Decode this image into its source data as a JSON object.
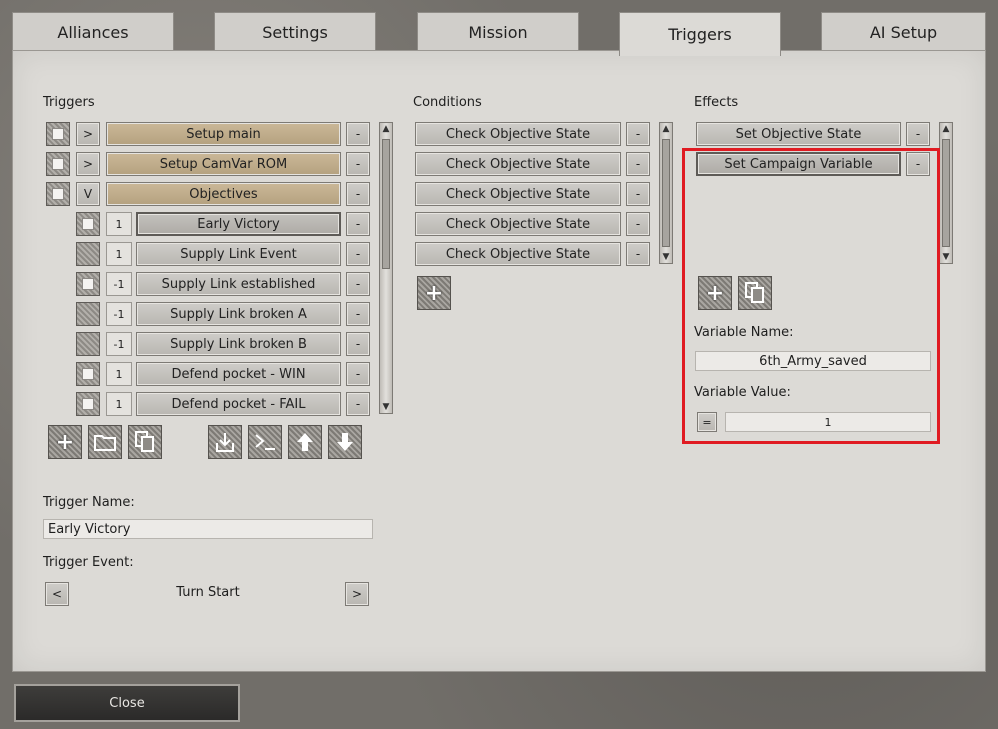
{
  "tabs": [
    "Alliances",
    "Settings",
    "Mission",
    "Triggers",
    "AI Setup"
  ],
  "triggers": {
    "heading": "Triggers",
    "items": [
      {
        "toggle": ">",
        "label": "Setup main",
        "remove": "-"
      },
      {
        "toggle": ">",
        "label": "Setup CamVar ROM",
        "remove": "-"
      },
      {
        "toggle": "V",
        "label": "Objectives",
        "remove": "-"
      },
      {
        "num": "1",
        "label": "Early Victory",
        "remove": "-"
      },
      {
        "num": "1",
        "label": "Supply Link Event",
        "remove": "-"
      },
      {
        "num": "-1",
        "label": "Supply Link established",
        "remove": "-"
      },
      {
        "num": "-1",
        "label": "Supply Link broken A",
        "remove": "-"
      },
      {
        "num": "-1",
        "label": "Supply Link broken B",
        "remove": "-"
      },
      {
        "num": "1",
        "label": "Defend pocket - WIN",
        "remove": "-"
      },
      {
        "num": "1",
        "label": "Defend pocket - FAIL",
        "remove": "-"
      }
    ],
    "trigger_name_label": "Trigger Name:",
    "trigger_name_value": "Early Victory",
    "trigger_event_label": "Trigger Event:",
    "trigger_event_value": "Turn Start",
    "prev": "<",
    "next": ">"
  },
  "conditions": {
    "heading": "Conditions",
    "items": [
      {
        "label": "Check Objective State",
        "remove": "-"
      },
      {
        "label": "Check Objective State",
        "remove": "-"
      },
      {
        "label": "Check Objective State",
        "remove": "-"
      },
      {
        "label": "Check Objective State",
        "remove": "-"
      },
      {
        "label": "Check Objective State",
        "remove": "-"
      }
    ]
  },
  "effects": {
    "heading": "Effects",
    "items": [
      {
        "label": "Set Objective State",
        "remove": "-"
      },
      {
        "label": "Set Campaign Variable",
        "remove": "-"
      }
    ],
    "variable_name_label": "Variable Name:",
    "variable_name_value": "6th_Army_saved",
    "variable_value_label": "Variable Value:",
    "operator": "=",
    "variable_value": "1"
  },
  "close_label": "Close",
  "colors": {
    "highlight": "#e01b22"
  }
}
